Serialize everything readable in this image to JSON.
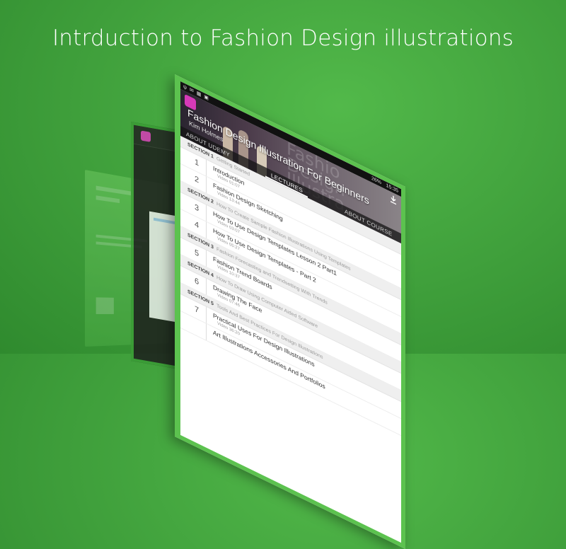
{
  "headline": "Intrduction to Fashion Design illustrations",
  "status_bar": {
    "icons": "ψ ✉ ▦ ▣",
    "battery": "26%",
    "time": "15:35"
  },
  "course": {
    "title": "Fashion Design Illustration For Beginners",
    "author": "Kim Holmes",
    "watermark_lines": [
      "Fashio",
      "Design",
      "Illustra"
    ]
  },
  "tabs": [
    {
      "label": "ABOUT UDEMY"
    },
    {
      "label": "LECTURES",
      "active": true
    },
    {
      "label": "ABOUT COURSE"
    }
  ],
  "sections": [
    {
      "label": "SECTION 1",
      "name": "Getting Started",
      "lectures": [
        {
          "num": "1",
          "title": "Introduction",
          "meta": "Video 01:07"
        },
        {
          "num": "2",
          "title": "Fashion Design Sketching",
          "meta": "Video 13:44"
        }
      ]
    },
    {
      "label": "SECTION 2",
      "name": "How To Create Sample Fashion Illustrations Using Templates",
      "lectures": [
        {
          "num": "3",
          "title": "How To Use Design Templates Lesson 2 Part1",
          "meta": "Video 03:07"
        },
        {
          "num": "4",
          "title": "How To Use Design Templates - Part 2",
          "meta": "Video 05:27"
        }
      ]
    },
    {
      "label": "SECTION 3",
      "name": "Fashion Forecasting and Trendsetting With Trends",
      "lectures": [
        {
          "num": "5",
          "title": "Fashion Trend Boards",
          "meta": "Video 10:37"
        }
      ]
    },
    {
      "label": "SECTION 4",
      "name": "How To Draw Using Computer Aided Software",
      "lectures": [
        {
          "num": "6",
          "title": "Drawing The Face",
          "meta": "Video 07:46"
        }
      ]
    },
    {
      "label": "SECTION 5",
      "name": "Tools And Best Practices For Design Illustrations",
      "lectures": [
        {
          "num": "7",
          "title": "Practical Uses For Design Illustrations",
          "meta": "Video 36:20"
        },
        {
          "num": "",
          "title": "Art Illustrations Accessories And Portfolios",
          "meta": ""
        }
      ]
    }
  ],
  "colors": {
    "background": "#45a83f",
    "phone_border": "#5cc24f",
    "app_logo": "#d63ab8"
  }
}
